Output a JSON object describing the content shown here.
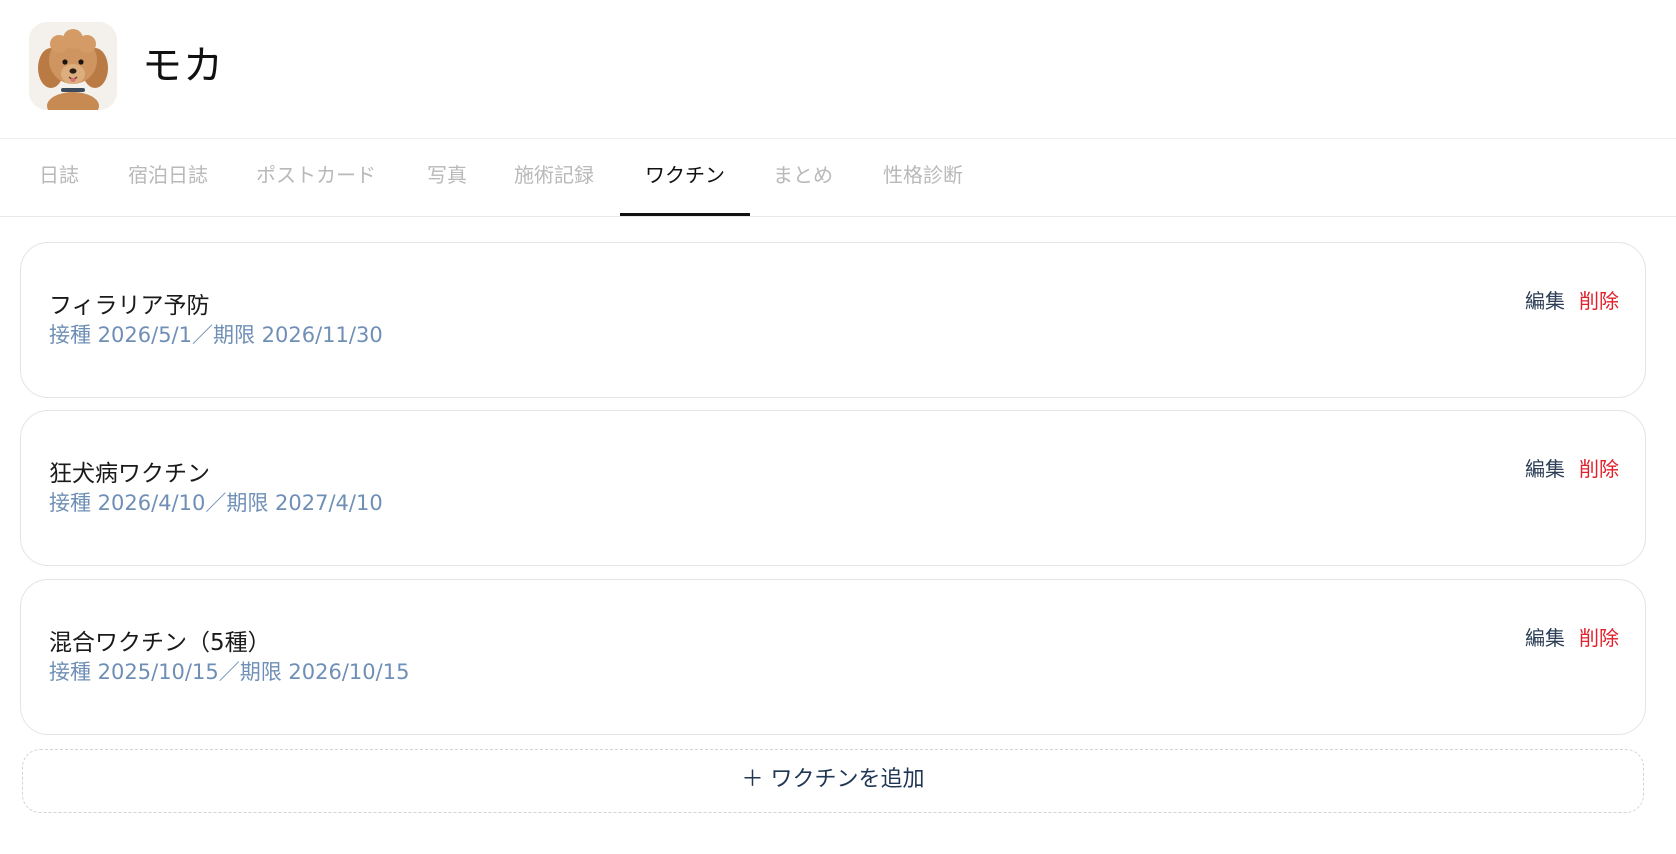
{
  "pet": {
    "name": "モカ",
    "avatar_icon": "poodle-photo"
  },
  "tabs": [
    {
      "label": "日誌",
      "active": false
    },
    {
      "label": "宿泊日誌",
      "active": false
    },
    {
      "label": "ポストカード",
      "active": false
    },
    {
      "label": "写真",
      "active": false
    },
    {
      "label": "施術記録",
      "active": false
    },
    {
      "label": "ワクチン",
      "active": true
    },
    {
      "label": "まとめ",
      "active": false
    },
    {
      "label": "性格診断",
      "active": false
    }
  ],
  "vaccines": [
    {
      "name": "フィラリア予防",
      "detail": "接種 2026/5/1／期限 2026/11/30"
    },
    {
      "name": "狂犬病ワクチン",
      "detail": "接種 2026/4/10／期限 2027/4/10"
    },
    {
      "name": "混合ワクチン（5種）",
      "detail": "接種 2025/10/15／期限 2026/10/15"
    }
  ],
  "actions": {
    "edit_label": "編集",
    "delete_label": "削除"
  },
  "add_button": {
    "label": "＋ ワクチンを追加"
  },
  "colors": {
    "edit": "#2c3e56",
    "delete": "#e0202a",
    "subtext": "#6f8fb6",
    "tab_inactive": "#b9b9b9",
    "tab_active": "#111111"
  }
}
